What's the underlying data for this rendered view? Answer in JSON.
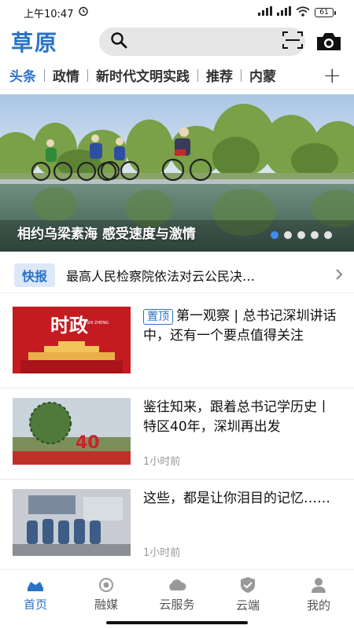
{
  "status_bar": {
    "time": "上午10:47",
    "battery": "61"
  },
  "header": {
    "logo": "草原",
    "search_placeholder": ""
  },
  "tabs": [
    {
      "label": "头条",
      "active": true
    },
    {
      "label": "政情",
      "active": false
    },
    {
      "label": "新时代文明实践",
      "active": false
    },
    {
      "label": "推荐",
      "active": false
    },
    {
      "label": "内蒙",
      "active": false
    }
  ],
  "banner": {
    "caption": "相约乌梁素海 感受速度与激情",
    "slide_count": 5,
    "active_slide": 1
  },
  "flash": {
    "badge": "快报",
    "text": "最高人民检察院依法对云公民决…"
  },
  "news": [
    {
      "tag": "置顶",
      "title": "第一观察 | 总书记深圳讲话中，还有一个要点值得关注",
      "time": "",
      "thumb_text": "时政",
      "thumb_sub": "SHI ZHENG"
    },
    {
      "tag": "",
      "title": "鉴往知来，跟着总书记学历史丨特区40年，深圳再出发",
      "time": "1小时前",
      "thumb_text": "40",
      "thumb_sub": ""
    },
    {
      "tag": "",
      "title": "这些，都是让你泪目的记忆……",
      "time": "1小时前",
      "thumb_text": "",
      "thumb_sub": ""
    }
  ],
  "bottom_nav": [
    {
      "label": "首页",
      "icon": "home-icon",
      "active": true
    },
    {
      "label": "融媒",
      "icon": "media-icon",
      "active": false
    },
    {
      "label": "云服务",
      "icon": "cloud-icon",
      "active": false
    },
    {
      "label": "云端",
      "icon": "shield-icon",
      "active": false
    },
    {
      "label": "我的",
      "icon": "user-icon",
      "active": false
    }
  ],
  "colors": {
    "accent": "#2a72c8",
    "flash_bg": "#dce8f8",
    "thumb_red": "#d0202a"
  }
}
